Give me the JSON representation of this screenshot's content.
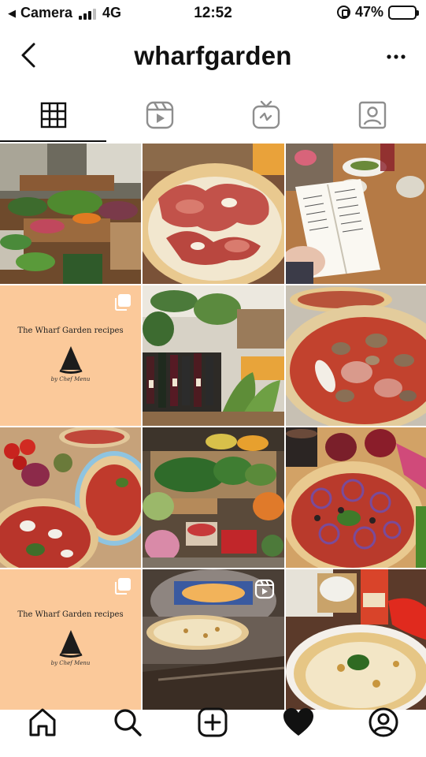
{
  "status_bar": {
    "carrier": "Camera",
    "network": "4G",
    "time": "12:52",
    "battery": "47%",
    "battery_level": 0.47
  },
  "header": {
    "title": "wharfgarden",
    "back_icon": "chevron-left-icon",
    "more_icon": "more-horizontal-icon"
  },
  "tabs": [
    {
      "name": "grid",
      "icon": "grid-icon",
      "active": true
    },
    {
      "name": "reels",
      "icon": "reels-icon",
      "active": false
    },
    {
      "name": "igtv",
      "icon": "igtv-icon",
      "active": false
    },
    {
      "name": "tagged",
      "icon": "tagged-icon",
      "active": false
    }
  ],
  "posts": [
    {
      "kind": "photo",
      "subject": "vegetable market stall"
    },
    {
      "kind": "photo",
      "subject": "prosciutto pizza"
    },
    {
      "kind": "photo",
      "subject": "reading a book at a table"
    },
    {
      "kind": "recipe",
      "title": "The Wharf Garden recipes",
      "byline": "by Chef Menu",
      "badge": "multi-photo-icon"
    },
    {
      "kind": "photo",
      "subject": "restaurant interior with wine bottles"
    },
    {
      "kind": "photo",
      "subject": "mushroom and ham pizza"
    },
    {
      "kind": "photo",
      "subject": "pizzas with tomatoes and onions"
    },
    {
      "kind": "photo",
      "subject": "produce display"
    },
    {
      "kind": "photo",
      "subject": "pizza with red onion and olives"
    },
    {
      "kind": "recipe",
      "title": "The Wharf Garden recipes",
      "byline": "by Chef Menu",
      "badge": "multi-photo-icon"
    },
    {
      "kind": "photo",
      "subject": "pizza in wood-fired oven",
      "badge": "reels-icon"
    },
    {
      "kind": "photo",
      "subject": "margherita pizza with basil"
    }
  ],
  "bottom_nav": [
    {
      "name": "home",
      "icon": "home-icon"
    },
    {
      "name": "search",
      "icon": "search-icon"
    },
    {
      "name": "new-post",
      "icon": "add-post-icon"
    },
    {
      "name": "activity",
      "icon": "heart-icon"
    },
    {
      "name": "profile",
      "icon": "profile-icon"
    }
  ],
  "colors": {
    "recipe_tile_bg": "#fbc99a",
    "text": "#111111"
  }
}
